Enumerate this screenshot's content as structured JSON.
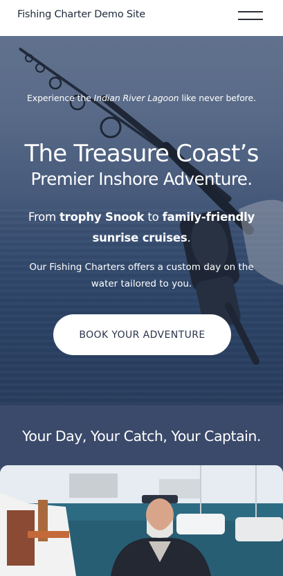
{
  "header": {
    "site_title": "Fishing Charter Demo Site",
    "menu_icon": "hamburger-menu-icon"
  },
  "hero": {
    "tagline_before": "Experience the ",
    "tagline_emphasis": "Indian River Lagoon",
    "tagline_after": " like never before.",
    "headline_line1": "The Treasure Coast’s",
    "headline_line2": "Premier Inshore Adventure.",
    "sub_from": "From ",
    "sub_bold1": "trophy Snook",
    "sub_to": " to ",
    "sub_bold2": "family-friendly",
    "sub_bold3": "sunrise cruises",
    "sub_end": ".",
    "desc_line1": "Our Fishing Charters offers a custom day on the",
    "desc_line2": "water tailored to you.",
    "cta_label": "BOOK YOUR ADVENTURE"
  },
  "section": {
    "heading": "Your Day, Your Catch, Your Captain."
  },
  "colors": {
    "header_bg": "#ffffff",
    "hero_overlay": "#3a4a6a",
    "section_bg": "#3b4a6a",
    "cta_bg": "#ffffff",
    "cta_text": "#2a3348"
  }
}
